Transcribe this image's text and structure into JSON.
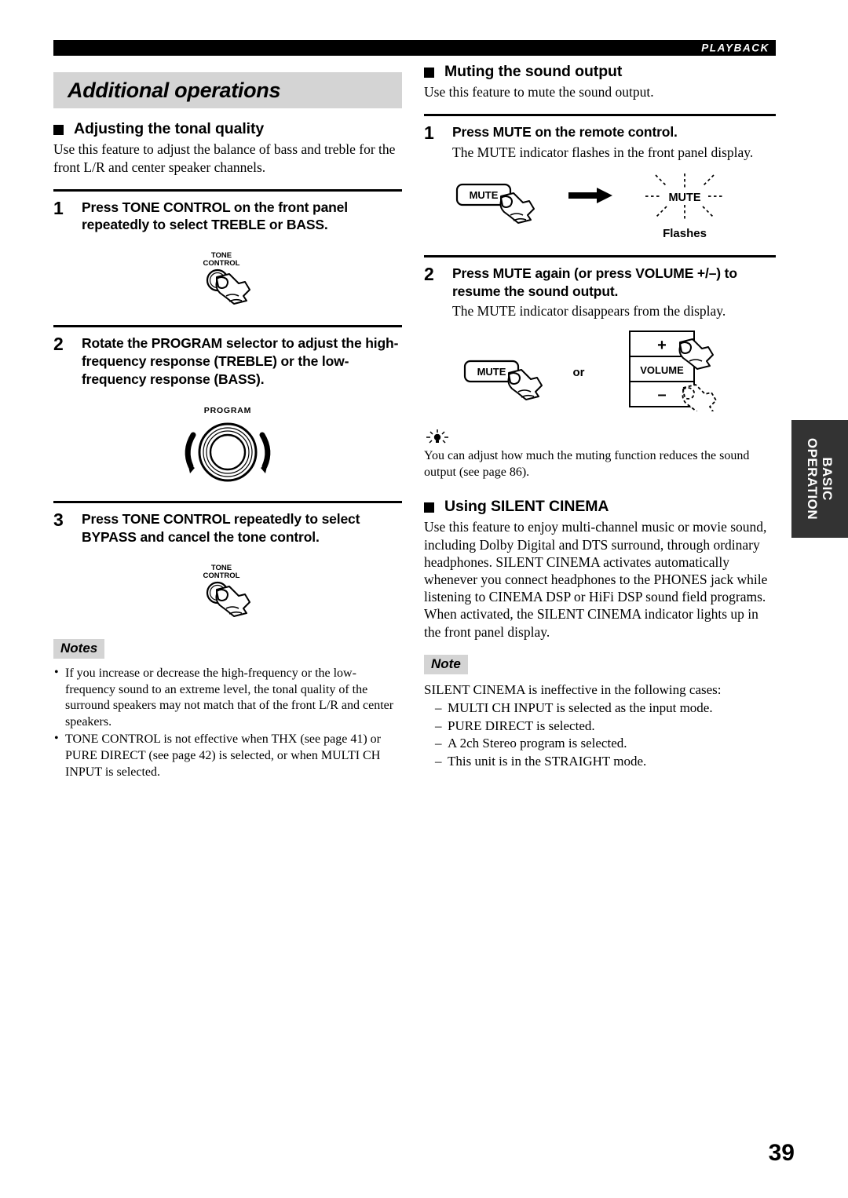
{
  "header": {
    "running_head": "PLAYBACK"
  },
  "chapter": {
    "title": "Additional operations"
  },
  "left_column": {
    "section": {
      "heading": "Adjusting the tonal quality",
      "intro": "Use this feature to adjust the balance of bass and treble for the front L/R and center speaker channels."
    },
    "steps": [
      {
        "number": "1",
        "title": "Press TONE CONTROL on the front panel repeatedly to select TREBLE or BASS.",
        "figure": {
          "kind": "button-press",
          "label_line1": "TONE",
          "label_line2": "CONTROL"
        }
      },
      {
        "number": "2",
        "title": "Rotate the PROGRAM selector to adjust the high-frequency response (TREBLE) or the low-frequency response (BASS).",
        "figure": {
          "kind": "rotary-knob",
          "label": "PROGRAM"
        }
      },
      {
        "number": "3",
        "title": "Press TONE CONTROL repeatedly to select BYPASS and cancel the tone control.",
        "figure": {
          "kind": "button-press",
          "label_line1": "TONE",
          "label_line2": "CONTROL"
        }
      }
    ],
    "notes": {
      "label": "Notes",
      "items": [
        "If you increase or decrease the high-frequency or the low-frequency sound to an extreme level, the tonal quality of the surround speakers may not match that of the front L/R and center speakers.",
        "TONE CONTROL is not effective when THX (see page 41) or PURE DIRECT (see page 42) is selected, or when MULTI CH INPUT is selected."
      ]
    }
  },
  "right_column": {
    "mute_section": {
      "heading": "Muting the sound output",
      "intro": "Use this feature to mute the sound output.",
      "steps": [
        {
          "number": "1",
          "title": "Press MUTE on the remote control.",
          "description": "The MUTE indicator flashes in the front panel display.",
          "figure": {
            "kind": "mute-flashes",
            "button_label": "MUTE",
            "indicator_label": "MUTE",
            "caption": "Flashes"
          }
        },
        {
          "number": "2",
          "title": "Press MUTE again (or press VOLUME +/–) to resume the sound output.",
          "description": "The MUTE indicator disappears from the display.",
          "figure": {
            "kind": "mute-or-volume",
            "button_label": "MUTE",
            "conjunction": "or",
            "volume_plus": "+",
            "volume_label": "VOLUME",
            "volume_minus": "–"
          }
        }
      ],
      "tip": {
        "icon": "lightbulb-tip-icon",
        "text": "You can adjust how much the muting function reduces the sound output (see page 86)."
      }
    },
    "silent_cinema": {
      "heading": "Using SILENT CINEMA",
      "body": "Use this feature to enjoy multi-channel music or movie sound, including Dolby Digital and DTS surround, through ordinary headphones. SILENT CINEMA activates automatically whenever you connect headphones to the PHONES jack while listening to CINEMA DSP or HiFi DSP sound field programs. When activated, the SILENT CINEMA indicator lights up in the front panel display.",
      "note": {
        "label": "Note",
        "intro": "SILENT CINEMA is ineffective in the following cases:",
        "items": [
          "MULTI CH INPUT is selected as the input mode.",
          "PURE DIRECT is selected.",
          "A 2ch Stereo program is selected.",
          "This unit is in the STRAIGHT mode."
        ]
      }
    }
  },
  "side_tab": {
    "line1": "BASIC",
    "line2": "OPERATION"
  },
  "footer": {
    "page_number": "39"
  },
  "colors": {
    "band_gray": "#d4d4d4",
    "tab_gray": "#333333",
    "ink": "#000000"
  }
}
